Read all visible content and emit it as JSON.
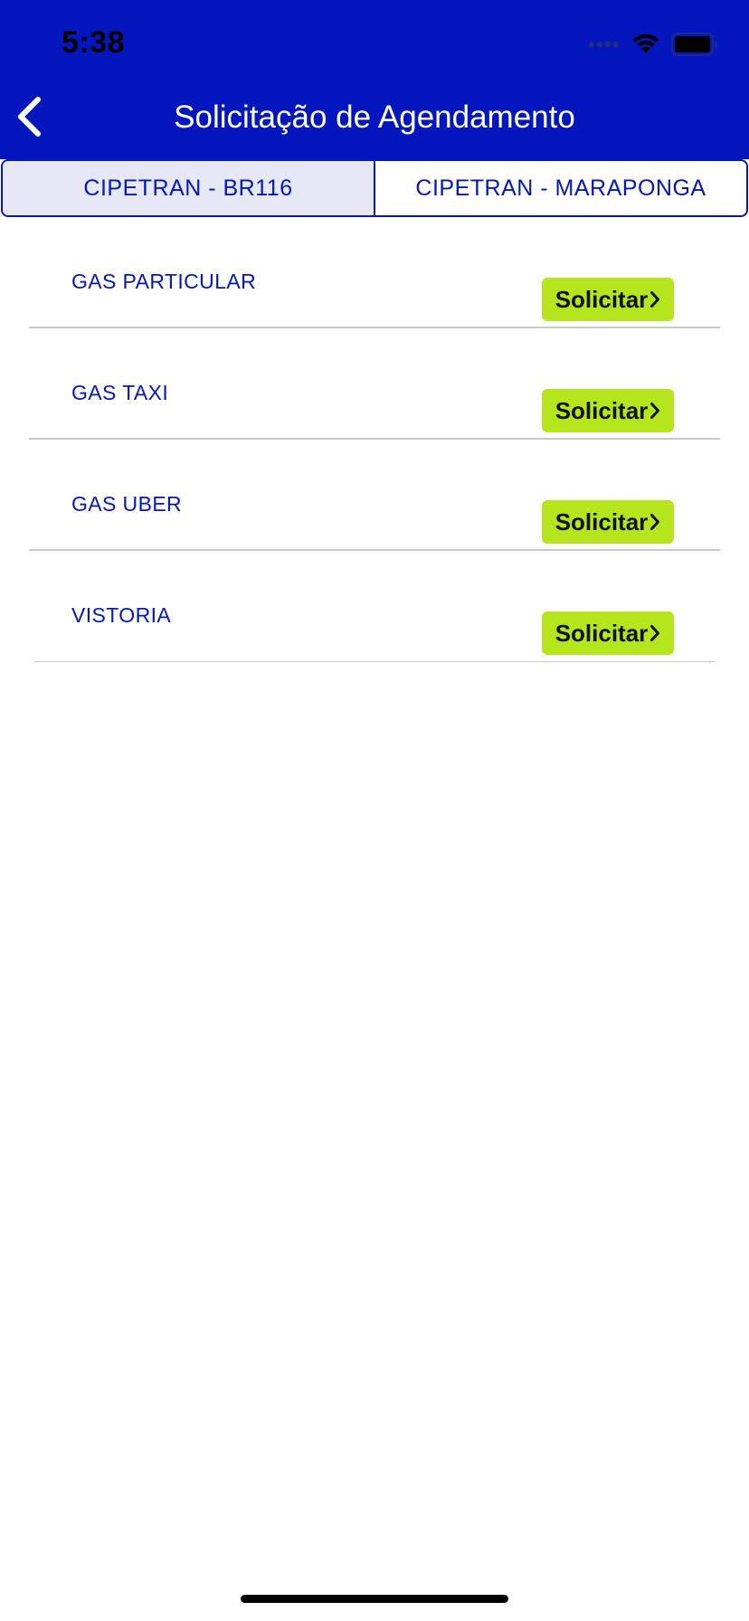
{
  "status_bar": {
    "time": "5:38"
  },
  "header": {
    "title": "Solicitação de Agendamento",
    "back_icon": "chevron-left-icon"
  },
  "tabs": [
    {
      "label": "CIPETRAN - BR116",
      "selected": true
    },
    {
      "label": "CIPETRAN - MARAPONGA",
      "selected": false
    }
  ],
  "items": [
    {
      "label": "GAS PARTICULAR",
      "button_label": "Solicitar"
    },
    {
      "label": "GAS TAXI",
      "button_label": "Solicitar"
    },
    {
      "label": "GAS UBER",
      "button_label": "Solicitar"
    },
    {
      "label": "VISTORIA",
      "button_label": "Solicitar"
    }
  ],
  "colors": {
    "header_bg": "#0416BE",
    "accent_text": "#0416BE",
    "button_bg": "#B5E61D",
    "selected_tab_bg": "#E6E8F6"
  }
}
